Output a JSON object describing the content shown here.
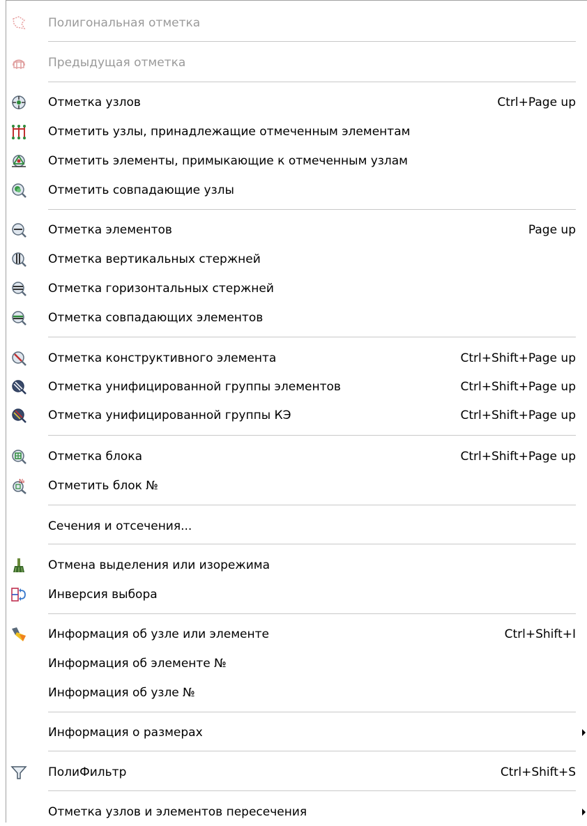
{
  "menu": {
    "items": [
      {
        "label": "Полигональная отметка",
        "shortcut": "",
        "icon": "polygon-select-icon",
        "disabled": true
      },
      {
        "label": "Предыдущая отметка",
        "shortcut": "",
        "icon": "previous-selection-icon",
        "disabled": true
      },
      {
        "label": "Отметка узлов",
        "shortcut": "Ctrl+Page up",
        "icon": "select-nodes-icon"
      },
      {
        "label": "Отметить узлы, принадлежащие отмеченным элементам",
        "shortcut": "",
        "icon": "nodes-of-elements-icon"
      },
      {
        "label": "Отметить элементы, примыкающие к отмеченным узлам",
        "shortcut": "",
        "icon": "elements-of-nodes-icon"
      },
      {
        "label": "Отметить совпадающие узлы",
        "shortcut": "",
        "icon": "coincident-nodes-icon"
      },
      {
        "label": "Отметка элементов",
        "shortcut": "Page up",
        "icon": "select-elements-icon"
      },
      {
        "label": "Отметка вертикальных стержней",
        "shortcut": "",
        "icon": "vertical-bars-icon"
      },
      {
        "label": "Отметка горизонтальных стержней",
        "shortcut": "",
        "icon": "horizontal-bars-icon"
      },
      {
        "label": "Отметка совпадающих элементов",
        "shortcut": "",
        "icon": "coincident-elements-icon"
      },
      {
        "label": "Отметка конструктивного элемента",
        "shortcut": "Ctrl+Shift+Page up",
        "icon": "structural-element-icon"
      },
      {
        "label": "Отметка унифицированной группы элементов",
        "shortcut": "Ctrl+Shift+Page up",
        "icon": "unified-element-group-icon"
      },
      {
        "label": "Отметка унифицированной группы КЭ",
        "shortcut": "Ctrl+Shift+Page up",
        "icon": "unified-fe-group-icon"
      },
      {
        "label": "Отметка блока",
        "shortcut": "Ctrl+Shift+Page up",
        "icon": "select-block-icon"
      },
      {
        "label": "Отметить блок №",
        "shortcut": "",
        "icon": "select-block-number-icon"
      },
      {
        "label": "Сечения и отсечения...",
        "shortcut": "",
        "icon": ""
      },
      {
        "label": "Отмена выделения или изорежима",
        "shortcut": "",
        "icon": "clear-selection-brush-icon"
      },
      {
        "label": "Инверсия выбора",
        "shortcut": "",
        "icon": "invert-selection-icon"
      },
      {
        "label": "Информация об узле или элементе",
        "shortcut": "Ctrl+Shift+I",
        "icon": "info-flashlight-icon"
      },
      {
        "label": "Информация об элементе №",
        "shortcut": "",
        "icon": ""
      },
      {
        "label": "Информация об узле №",
        "shortcut": "",
        "icon": ""
      },
      {
        "label": "Информация о размерах",
        "shortcut": "",
        "icon": "",
        "submenu": true
      },
      {
        "label": "ПолиФильтр",
        "shortcut": "Ctrl+Shift+S",
        "icon": "filter-funnel-icon"
      },
      {
        "label": "Отметка узлов и элементов пересечения",
        "shortcut": "",
        "icon": "",
        "submenu": true
      }
    ]
  }
}
